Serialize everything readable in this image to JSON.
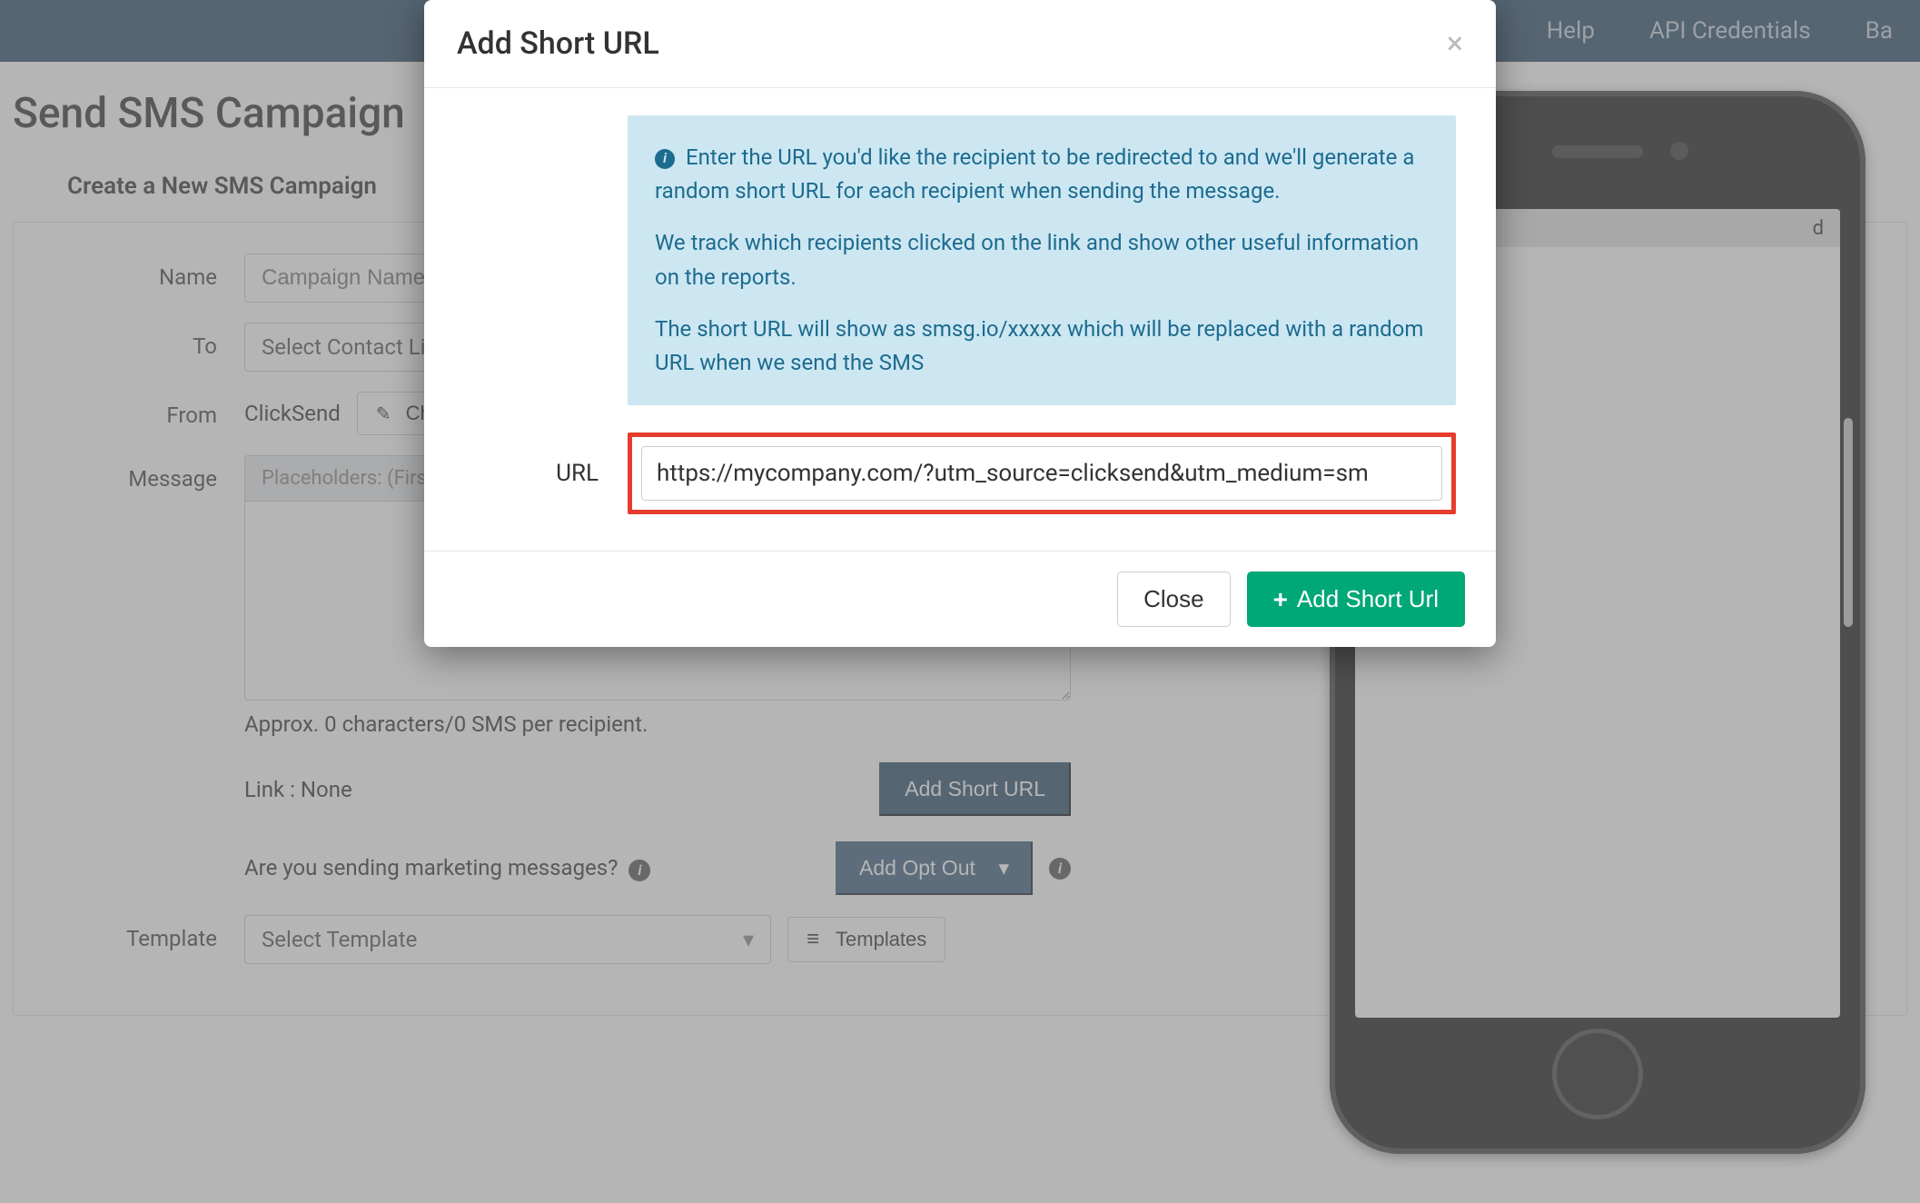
{
  "nav": {
    "help": "Help",
    "api": "API Credentials",
    "balance": "Ba"
  },
  "page": {
    "title": "Send SMS Campaign",
    "panel_heading": "Create a New SMS Campaign"
  },
  "form": {
    "name_label": "Name",
    "name_placeholder": "Campaign Name",
    "to_label": "To",
    "to_placeholder": "Select Contact List",
    "from_label": "From",
    "from_value": "ClickSend",
    "change_button": "Change",
    "message_label": "Message",
    "placeholders_text": "Placeholders: (First Name",
    "char_hint": "Approx. 0 characters/0 SMS per recipient.",
    "link_label": "Link : None",
    "add_short_url_btn": "Add Short URL",
    "marketing_question": "Are you sending marketing messages?",
    "add_opt_out_btn": "Add Opt Out",
    "template_label": "Template",
    "select_template_placeholder": "Select Template",
    "templates_btn": "Templates"
  },
  "phone": {
    "status_text": "d"
  },
  "modal": {
    "title": "Add Short URL",
    "info_p1": "Enter the URL you'd like the recipient to be redirected to and we'll generate a random short URL for each recipient when sending the message.",
    "info_p2": "We track which recipients clicked on the link and show other useful information on the reports.",
    "info_p3": "The short URL will show as smsg.io/xxxxx which will be replaced with a random URL when we send the SMS",
    "url_label": "URL",
    "url_value": "https://mycompany.com/?utm_source=clicksend&utm_medium=sm",
    "close_btn": "Close",
    "add_btn": "Add Short Url"
  }
}
